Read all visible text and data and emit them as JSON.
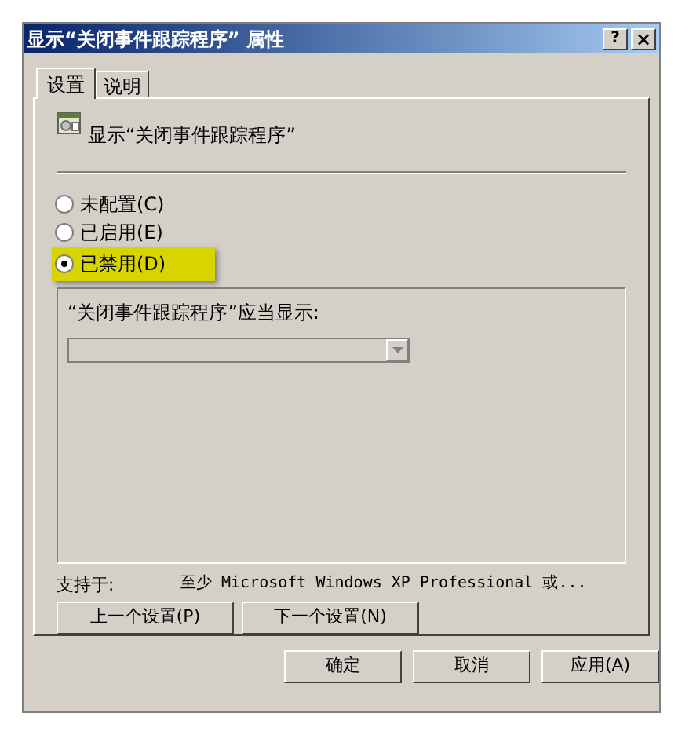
{
  "window": {
    "title": "显示“关闭事件跟踪程序” 属性",
    "help": "?",
    "close": "×"
  },
  "tabs": [
    {
      "label": "设置",
      "selected": true
    },
    {
      "label": "说明",
      "selected": false
    }
  ],
  "setting_name": "显示“关闭事件跟踪程序”",
  "options": [
    {
      "label": "未配置(C)",
      "selected": false,
      "highlighted": false
    },
    {
      "label": "已启用(E)",
      "selected": false,
      "highlighted": false
    },
    {
      "label": "已禁用(D)",
      "selected": true,
      "highlighted": true
    }
  ],
  "group": {
    "label": "“关闭事件跟踪程序”应当显示:",
    "dropdown": {
      "disabled": true
    }
  },
  "supported": {
    "label": "支持于:",
    "value": "至少 Microsoft Windows XP Professional 或..."
  },
  "nav_buttons": [
    "上一个设置(P)",
    "下一个设置(N)"
  ],
  "buttons": [
    "确定",
    "取消",
    "应用(A)"
  ]
}
